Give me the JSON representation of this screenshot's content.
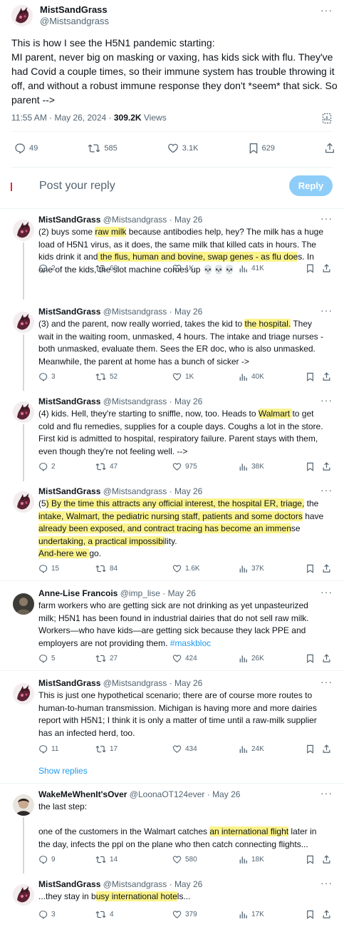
{
  "main": {
    "name": "MistSandGrass",
    "handle": "@Mistsandgrass",
    "text_lines": [
      "This is how I see the H5N1 pandemic starting:",
      "MI parent, never big on masking or vaxing, has kids sick with flu. They've",
      "had Covid a couple times, so their immune system has trouble throwing it",
      "off, and without a robust immune response they don't *seem* that sick. So",
      "parent -->"
    ],
    "time": "11:55 AM · May 26, 2024 · ",
    "views": "309.2K",
    "views_label": " Views",
    "stats": {
      "replies": "49",
      "reposts": "585",
      "likes": "3.1K",
      "bookmarks": "629"
    }
  },
  "reply_box": {
    "placeholder": "Post your reply",
    "button": "Reply"
  },
  "tweets": [
    {
      "name": "MistSandGrass",
      "handle": "@Mistsandgrass",
      "date": "· May 26",
      "body": [
        [
          {
            "t": "(2) buys some "
          },
          {
            "t": "raw milk",
            "h": true
          },
          {
            "t": " because antibodies help, hey? The milk has a huge"
          }
        ],
        [
          {
            "t": "load of H5N1 virus, as it does, the same milk that killed cats in hours. The"
          }
        ],
        [
          {
            "t": "kids drink it and"
          },
          {
            "t": " the flus, human and bovine, swap genes - as flu doe",
            "h": true
          },
          {
            "t": "s. In"
          }
        ],
        [
          {
            "t": "one of the kids, the slot machine comes up 💀💀💀"
          }
        ]
      ],
      "stats": {
        "replies": "2",
        "reposts": "60",
        "likes": "1K",
        "views": "41K"
      }
    },
    {
      "name": "MistSandGrass",
      "handle": "@Mistsandgrass",
      "date": "· May 26",
      "body": [
        [
          {
            "t": "(3) and the parent, now really worried, takes the kid to "
          },
          {
            "t": "the hospital.",
            "h": true
          },
          {
            "t": " They"
          }
        ],
        [
          {
            "t": "wait in the waiting room, unmasked, 4 hours. The intake and triage nurses -"
          }
        ],
        [
          {
            "t": "both unmasked, evaluate them. Sees the ER doc, who is also unmasked."
          }
        ],
        [
          {
            "t": "Meanwhile, the parent at home has a bunch of sicker ->"
          }
        ]
      ],
      "stats": {
        "replies": "3",
        "reposts": "52",
        "likes": "1K",
        "views": "40K"
      }
    },
    {
      "name": "MistSandGrass",
      "handle": "@Mistsandgrass",
      "date": "· May 26",
      "body": [
        [
          {
            "t": "(4) kids. Hell, they're starting to sniffle, now, too. Heads to "
          },
          {
            "t": "Walmart ",
            "h": true
          },
          {
            "t": "to get"
          }
        ],
        [
          {
            "t": "cold and flu remedies, supplies for a couple days. Coughs a lot in the store."
          }
        ],
        [
          {
            "t": "First kid is admitted to hospital, respiratory failure. Parent stays with them,"
          }
        ],
        [
          {
            "t": "even though they're not feeling well. -->"
          }
        ]
      ],
      "stats": {
        "replies": "2",
        "reposts": "47",
        "likes": "975",
        "views": "38K"
      }
    },
    {
      "name": "MistSandGrass",
      "handle": "@Mistsandgrass",
      "date": "· May 26",
      "body": [
        [
          {
            "t": "(5"
          },
          {
            "t": ") By the time this attracts any official interest, the hospital ER, triage,",
            "h": true
          },
          {
            "t": " the"
          }
        ],
        [
          {
            "t": "intake, Walmart, the pediatric nursing staff, patients and some doctors",
            "h": true
          },
          {
            "t": " have"
          }
        ],
        [
          {
            "t": "already been exposed, and contract tracing has become an immen",
            "h": true
          },
          {
            "t": "se"
          }
        ],
        [
          {
            "t": "undertaking, a practical impossibi",
            "h": true
          },
          {
            "t": "lity."
          }
        ],
        [
          {
            "t": "And-here we ",
            "h": true
          },
          {
            "t": "go."
          }
        ]
      ],
      "stats": {
        "replies": "15",
        "reposts": "84",
        "likes": "1.6K",
        "views": "37K"
      }
    },
    {
      "name": "Anne-Lise Francois",
      "handle": "@imp_lise",
      "date": "· May 26",
      "body": [
        [
          {
            "t": "farm workers who are getting sick are not drinking as yet unpasteurized"
          }
        ],
        [
          {
            "t": "milk; H5N1 has been found in industrial dairies that do not sell raw milk."
          }
        ],
        [
          {
            "t": "Workers—who have kids—are getting sick because they lack PPE and"
          }
        ],
        [
          {
            "t": "employers are not providing them. "
          },
          {
            "t": "#maskbloc",
            "tag": true
          }
        ]
      ],
      "stats": {
        "replies": "5",
        "reposts": "27",
        "likes": "424",
        "views": "26K"
      }
    },
    {
      "name": "MistSandGrass",
      "handle": "@Mistsandgrass",
      "date": "· May 26",
      "body": [
        [
          {
            "t": "This is just one hypothetical scenario; there are of course more routes to"
          }
        ],
        [
          {
            "t": "human-to-human transmission. Michigan is having more and more dairies"
          }
        ],
        [
          {
            "t": "report with H5N1; I think it is only a matter of time until a raw-milk supplier"
          }
        ],
        [
          {
            "t": "has an infected herd, too."
          }
        ]
      ],
      "stats": {
        "replies": "11",
        "reposts": "17",
        "likes": "434",
        "views": "24K"
      },
      "show_replies": "Show replies"
    },
    {
      "name": "WakeMeWhenIt'sOver",
      "handle": "@LoonaOT124ever",
      "date": "· May 26",
      "body": [
        [
          {
            "t": "the last step:"
          }
        ],
        [
          {
            "t": " "
          }
        ],
        [
          {
            "t": "one of the customers in the Walmart catches "
          },
          {
            "t": "an international flight",
            "h": true
          },
          {
            "t": " later in"
          }
        ],
        [
          {
            "t": "the day, infects the ppl on the plane who then catch connecting flights..."
          }
        ]
      ],
      "stats": {
        "replies": "9",
        "reposts": "14",
        "likes": "580",
        "views": "18K"
      }
    },
    {
      "name": "MistSandGrass",
      "handle": "@Mistsandgrass",
      "date": "· May 26",
      "body": [
        [
          {
            "t": "...they stay in b"
          },
          {
            "t": "usy international hote",
            "h": true
          },
          {
            "t": "ls..."
          }
        ]
      ],
      "stats": {
        "replies": "3",
        "reposts": "4",
        "likes": "379",
        "views": "17K"
      }
    }
  ],
  "icons": {
    "more": "more-dots-icon",
    "reply": "reply-icon",
    "repost": "repost-icon",
    "like": "like-icon",
    "views": "views-icon",
    "bookmark": "bookmark-icon",
    "share": "share-icon"
  },
  "colors": {
    "accent": "#1d9bf0",
    "highlight": "#fbf38c",
    "muted": "#536471",
    "reply_button": "#8ecdf8"
  }
}
